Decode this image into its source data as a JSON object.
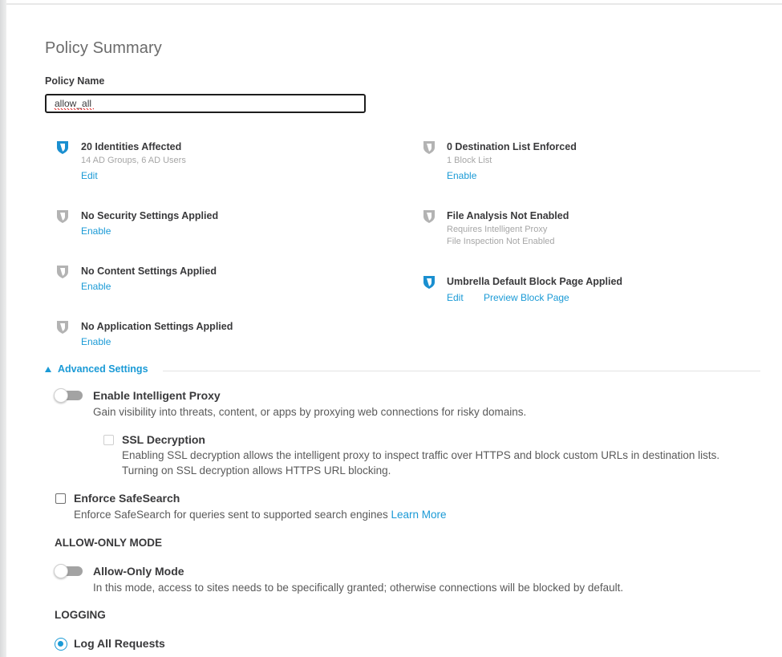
{
  "page": {
    "title": "Policy Summary"
  },
  "policy_name": {
    "label": "Policy Name",
    "value": "allow_all"
  },
  "summary": {
    "identities": {
      "icon": "shield-active-icon",
      "title": "20 Identities Affected",
      "subtitle": "14 AD Groups, 6 AD Users",
      "link": "Edit"
    },
    "security": {
      "icon": "shield-inactive-icon",
      "title": "No Security Settings Applied",
      "link": "Enable"
    },
    "content": {
      "icon": "shield-inactive-icon",
      "title": "No Content Settings Applied",
      "link": "Enable"
    },
    "application": {
      "icon": "shield-inactive-icon",
      "title": "No Application Settings Applied",
      "link": "Enable"
    },
    "destination": {
      "icon": "shield-inactive-icon",
      "title": "0 Destination List Enforced",
      "subtitle": "1 Block List",
      "link": "Enable"
    },
    "file_analysis": {
      "icon": "shield-inactive-icon",
      "title": "File Analysis Not Enabled",
      "subtitle1": "Requires Intelligent Proxy",
      "subtitle2": "File Inspection Not Enabled"
    },
    "block_page": {
      "icon": "shield-active-icon",
      "title": "Umbrella Default Block Page Applied",
      "link_edit": "Edit",
      "link_preview": "Preview Block Page"
    }
  },
  "advanced": {
    "label": "Advanced Settings",
    "expanded": true,
    "intelligent_proxy": {
      "title": "Enable Intelligent Proxy",
      "description": "Gain visibility into threats, content, or apps by proxying web connections for risky domains.",
      "enabled": false
    },
    "ssl_decryption": {
      "title": "SSL Decryption",
      "description_line1": "Enabling SSL decryption allows the intelligent proxy to inspect traffic over HTTPS and block custom URLs in destination lists.",
      "description_line2": "Turning on SSL decryption allows HTTPS URL blocking.",
      "checked": false
    },
    "safesearch": {
      "title": "Enforce SafeSearch",
      "description": "Enforce SafeSearch for queries sent to supported search engines",
      "link": "Learn More",
      "checked": false
    }
  },
  "allow_only": {
    "section_title": "ALLOW-ONLY MODE",
    "title": "Allow-Only Mode",
    "description": "In this mode, access to sites needs to be specifically granted; otherwise connections will be blocked by default.",
    "enabled": false
  },
  "logging": {
    "section_title": "LOGGING",
    "options": [
      {
        "label": "Log All Requests",
        "selected": true
      }
    ]
  },
  "colors": {
    "accent": "#1a9ad6",
    "shield_active": "#1a8fd0",
    "shield_inactive": "#b3b3b3",
    "text": "#39393b",
    "muted": "#a6a6a6"
  }
}
